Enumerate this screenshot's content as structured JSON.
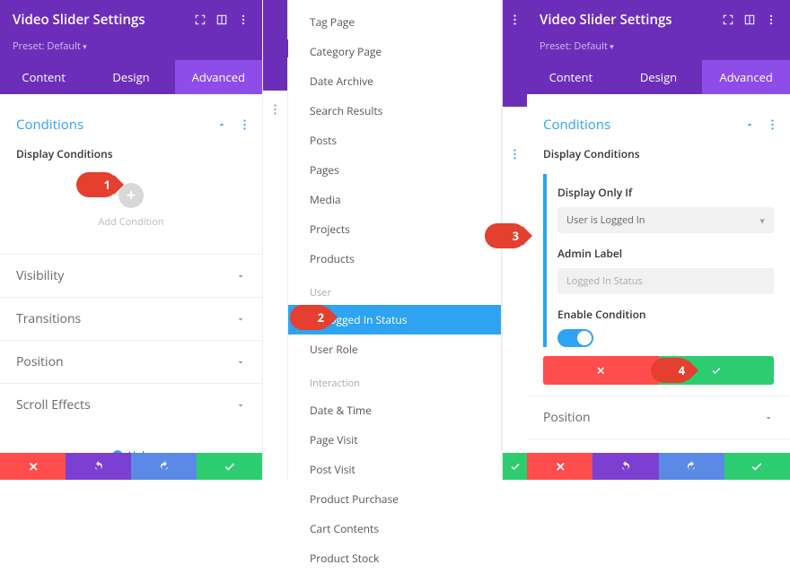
{
  "header": {
    "title": "Video Slider Settings",
    "preset": "Preset: Default"
  },
  "tabs": {
    "content": "Content",
    "design": "Design",
    "advanced": "Advanced"
  },
  "sections": {
    "conditions": "Conditions",
    "display_conditions": "Display Conditions",
    "visibility": "Visibility",
    "transitions": "Transitions",
    "position": "Position",
    "scroll_effects": "Scroll Effects"
  },
  "add_condition": "Add Condition",
  "help": "Help",
  "dropdown": {
    "location_items": [
      "Tag Page",
      "Category Page",
      "Date Archive",
      "Search Results",
      "Posts",
      "Pages",
      "Media",
      "Projects",
      "Products"
    ],
    "user_group": "User",
    "user_items": [
      "Logged In Status",
      "User Role"
    ],
    "interaction_group": "Interaction",
    "interaction_items": [
      "Date & Time",
      "Page Visit",
      "Post Visit",
      "Product Purchase",
      "Cart Contents",
      "Product Stock"
    ]
  },
  "condition_card": {
    "display_only_if": "Display Only If",
    "select_value": "User is Logged In",
    "admin_label": "Admin Label",
    "admin_placeholder": "Logged In Status",
    "enable_condition": "Enable Condition"
  },
  "markers": {
    "m1": "1",
    "m2": "2",
    "m3": "3",
    "m4": "4"
  }
}
